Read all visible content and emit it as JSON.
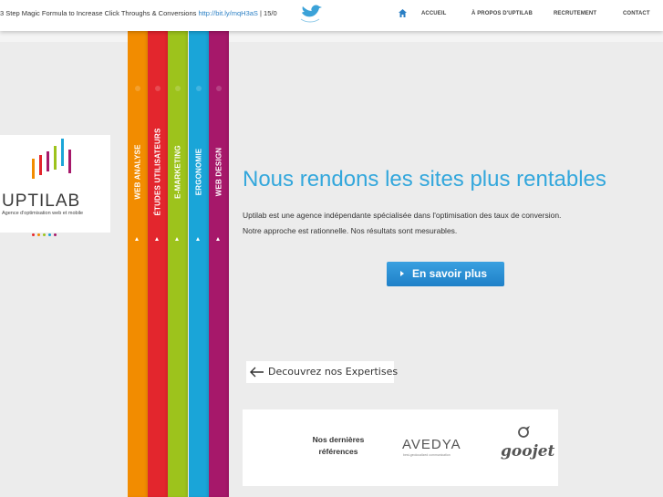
{
  "topbar": {
    "ticker_text": "3 Step Magic Formula to Increase Click Throughs & Conversions ",
    "ticker_link": "http://bit.ly/mqH3aS",
    "ticker_suffix": " | 15/0",
    "nav": [
      "ACCUEIL",
      "À PROPOS D'UPTILAB",
      "RECRUTEMENT",
      "CONTACT"
    ]
  },
  "logo": {
    "word": "UPTILAB",
    "subtitle": "Agence d'optimisation web et mobile",
    "dot_colors": [
      "#e8262b",
      "#f28c00",
      "#9bc31c",
      "#1aa2d8",
      "#a51a6b"
    ]
  },
  "stripes": [
    {
      "label": "WEB ANALYSE",
      "color": "#f28c00"
    },
    {
      "label": "ÉTUDES UTILISATEURS",
      "color": "#e3262d"
    },
    {
      "label": "E-MARKETING",
      "color": "#9dc31c"
    },
    {
      "label": "ERGONOMIE",
      "color": "#1aa5d8"
    },
    {
      "label": "WEB DESIGN",
      "color": "#a6186a"
    }
  ],
  "main": {
    "headline": "Nous rendons les sites plus rentables",
    "description_line1": "Uptilab est une agence indépendante spécialisée dans l'optimisation des taux de conversion.",
    "description_line2": "Notre approche est rationnelle. Nos résultats sont mesurables.",
    "cta_label": "En savoir plus",
    "discover_label": "Decouvrez nos Expertises"
  },
  "references": {
    "label_line1": "Nos dernières",
    "label_line2": "références",
    "avedya": "AVEDYA",
    "avedya_sub": "best-geolocalized communication",
    "goojet": "goojet"
  }
}
